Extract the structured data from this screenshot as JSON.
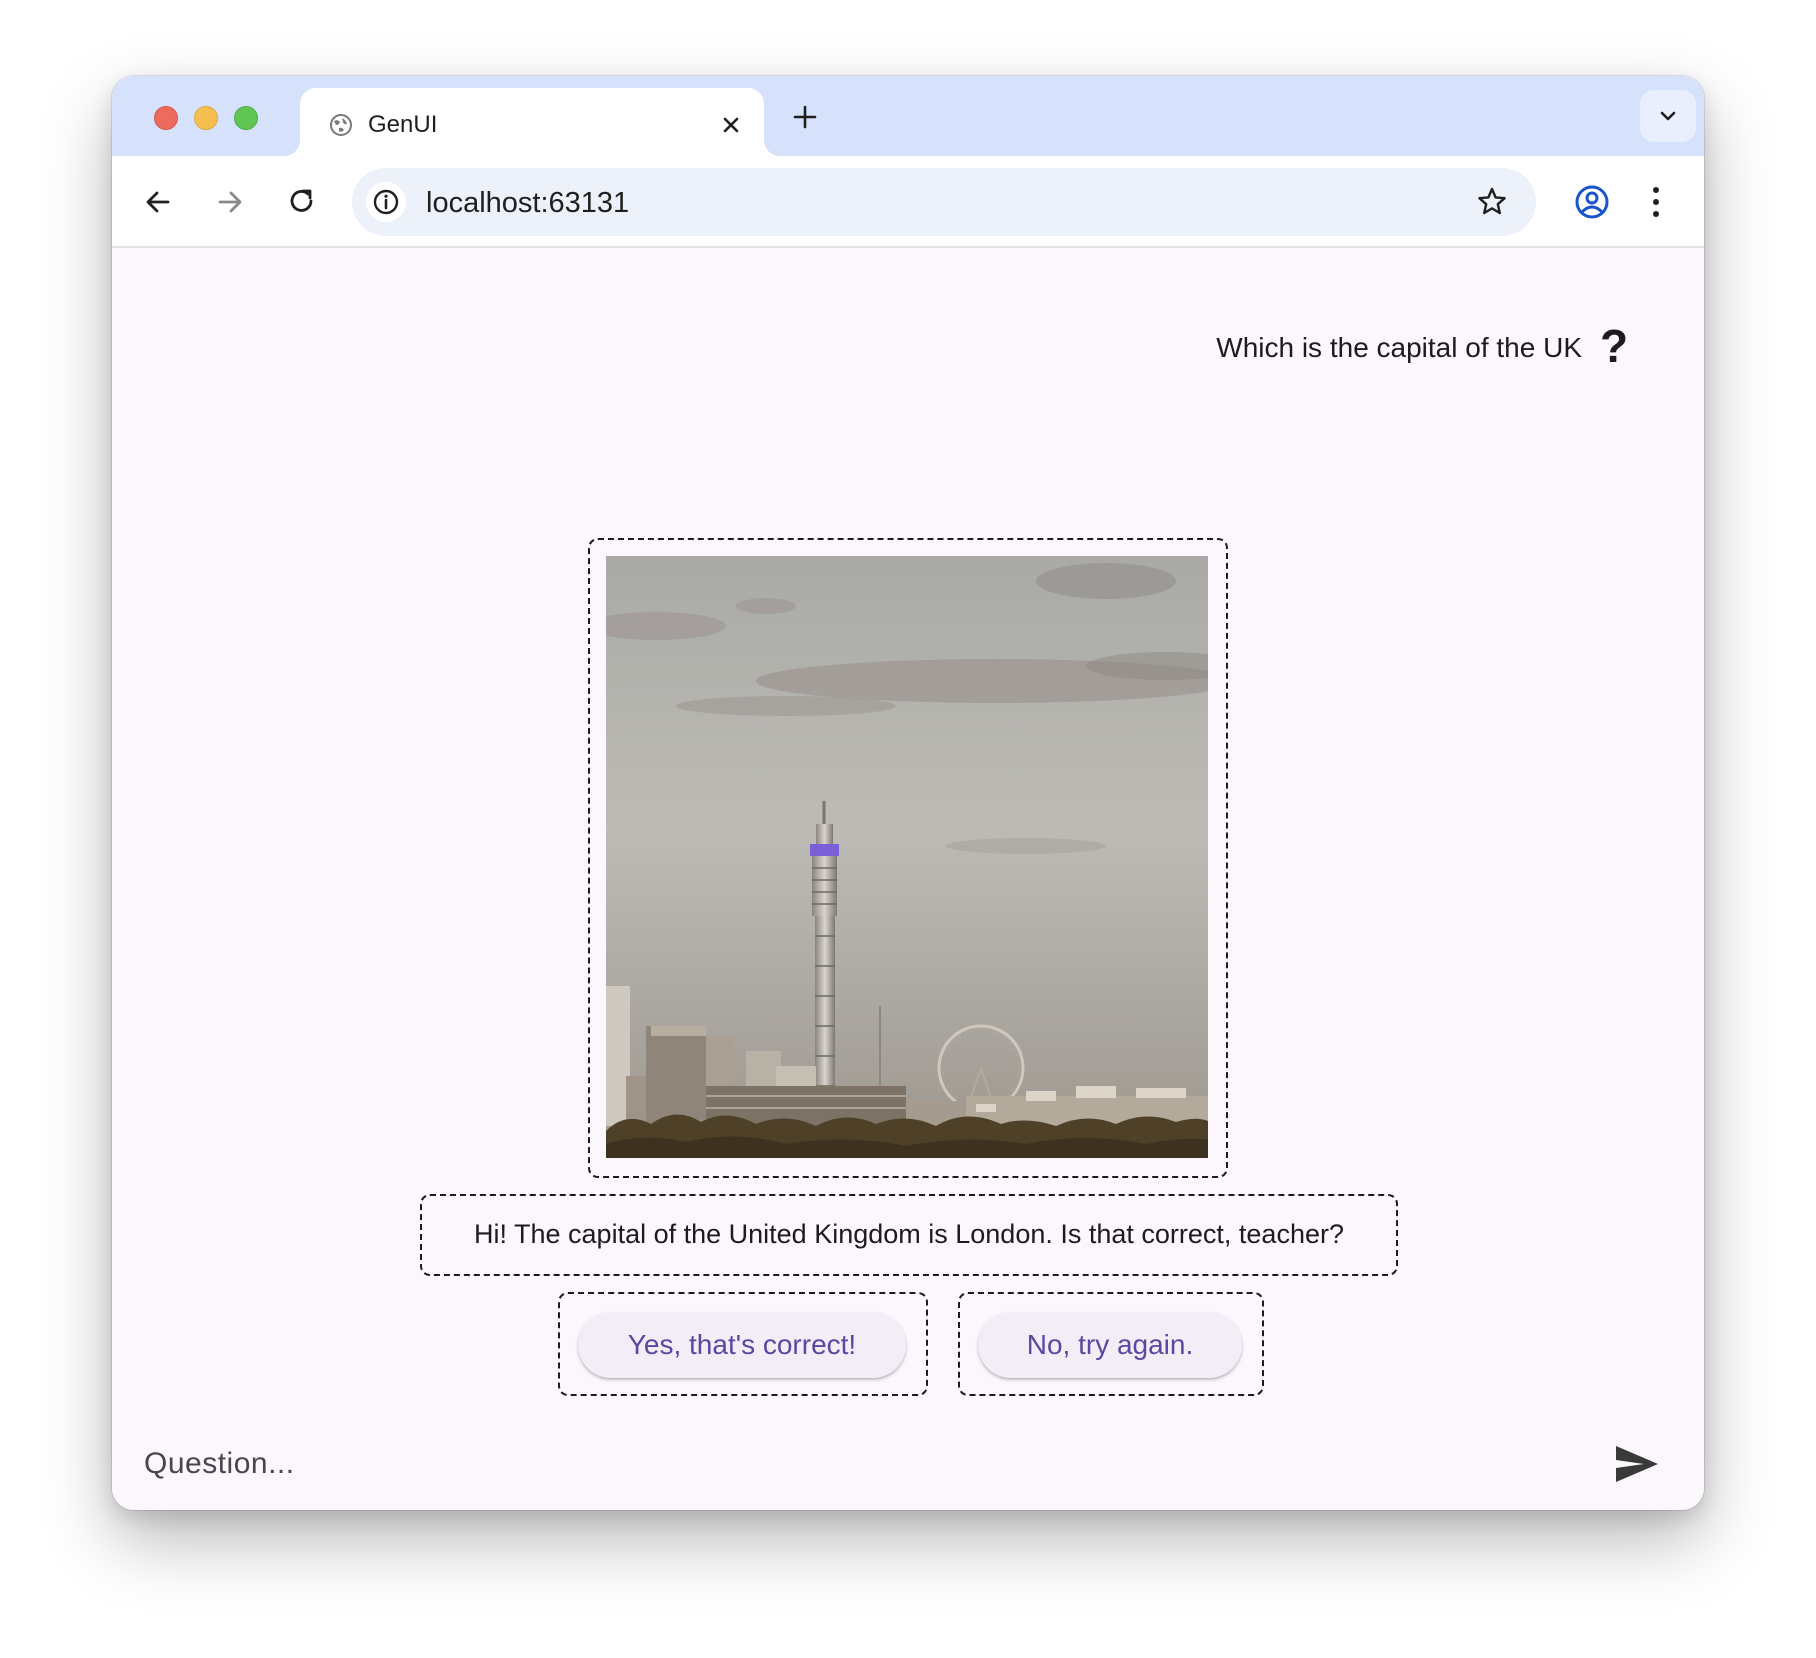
{
  "browser": {
    "tab_title": "GenUI",
    "url": "localhost:63131",
    "icons": {
      "favicon": "globe-icon",
      "tab_close": "close-icon",
      "new_tab": "plus-icon",
      "tab_menu": "chevron-down-icon",
      "back": "arrow-left-icon",
      "forward": "arrow-right-icon",
      "reload": "reload-icon",
      "site_info": "info-icon",
      "bookmark": "star-icon",
      "profile": "profile-icon",
      "menu": "kebab-menu-icon"
    },
    "colors": {
      "tabstrip": "#d6e2fb",
      "omnibox": "#edf1f9"
    }
  },
  "chat": {
    "user_message": "Which is the capital of the UK",
    "user_avatar_glyph": "?",
    "image_subject": "london-skyline-photo",
    "answer_text": "Hi! The capital of the United Kingdom is London. Is that correct, teacher?",
    "buttons": {
      "yes_label": "Yes, that's correct!",
      "no_label": "No, try again."
    },
    "input_placeholder": "Question...",
    "send_icon": "send-icon",
    "colors": {
      "background": "#fbf7fd",
      "button_text": "#5b47a0",
      "button_bg": "#f2eef8"
    }
  }
}
